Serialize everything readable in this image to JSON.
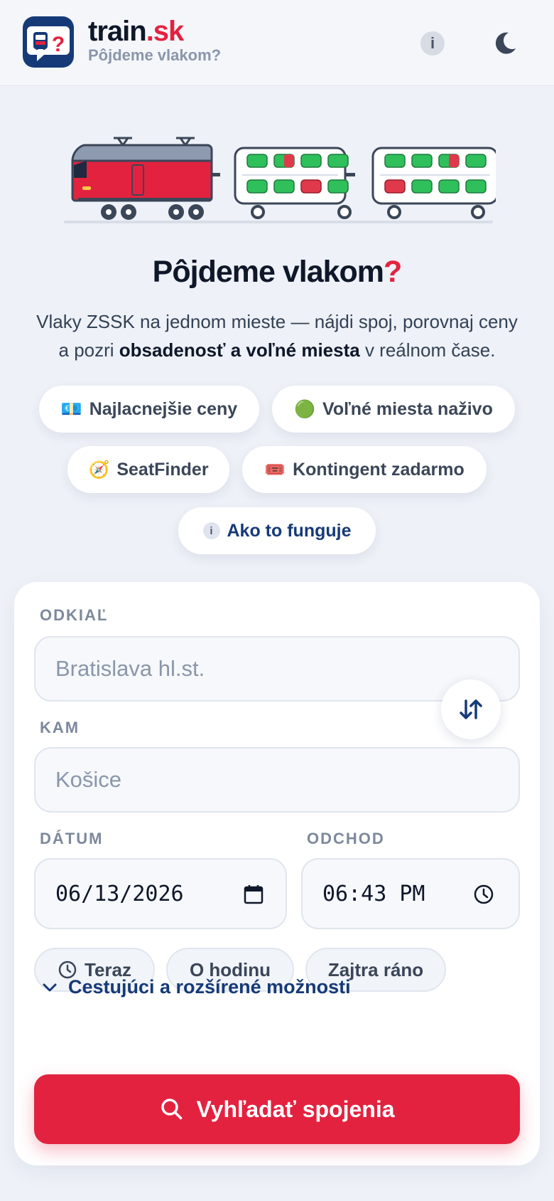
{
  "header": {
    "brand_main": "train",
    "brand_accent": ".sk",
    "subtitle": "Pôjdeme vlakom?",
    "info_label": "i",
    "logo_icon": "train-question-icon",
    "theme_icon": "moon-icon"
  },
  "hero": {
    "title_main": "Pôjdeme vlakom",
    "title_mark": "?",
    "desc_line1": "Vlaky ZSSK na jednom mieste — nájdi spoj, porovnaj ceny",
    "desc_line2_pre": "a pozri ",
    "desc_line2_bold": "obsadenosť a voľné miesta",
    "desc_line2_post": " v reálnom čase."
  },
  "features": {
    "cheapest": {
      "emoji": "💶",
      "label": "Najlacnejšie ceny"
    },
    "free_seats": {
      "emoji": "🟢",
      "label": "Voľné miesta naživo"
    },
    "seatfinder": {
      "emoji": "🧭",
      "label": "SeatFinder"
    },
    "quota": {
      "emoji": "🎟️",
      "label": "Kontingent zadarmo"
    },
    "how": {
      "icon": "i",
      "label": "Ako to funguje"
    }
  },
  "form": {
    "from_label": "ODKIAĽ",
    "from_placeholder": "Bratislava hl.st.",
    "to_label": "KAM",
    "to_placeholder": "Košice",
    "date_label": "DÁTUM",
    "date_value": "06/13/2026",
    "time_label": "ODCHOD",
    "time_value": "06:43 PM",
    "quick_now": "Teraz",
    "quick_hour": "O hodinu",
    "quick_tomorrow": "Zajtra ráno",
    "expander_label": "Cestujúci a rozšírené možnosti",
    "search_label": "Vyhľadať spojenia"
  },
  "colors": {
    "accent_red": "#e3223f",
    "brand_navy": "#163a78",
    "seat_free": "#2fbf5b",
    "seat_taken": "#e0394c"
  }
}
